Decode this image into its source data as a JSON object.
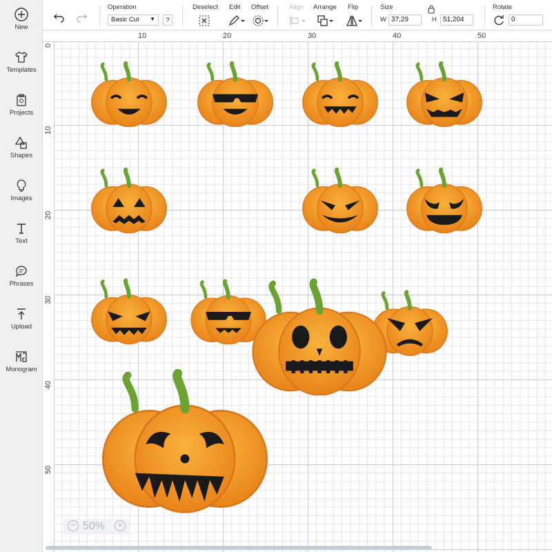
{
  "sidebar": {
    "items": [
      {
        "label": "New",
        "icon": "plus-circle-icon"
      },
      {
        "label": "Templates",
        "icon": "tshirt-icon"
      },
      {
        "label": "Projects",
        "icon": "projects-icon"
      },
      {
        "label": "Shapes",
        "icon": "shapes-icon"
      },
      {
        "label": "Images",
        "icon": "lightbulb-icon"
      },
      {
        "label": "Text",
        "icon": "text-icon"
      },
      {
        "label": "Phrases",
        "icon": "speech-bubble-icon"
      },
      {
        "label": "Upload",
        "icon": "upload-icon"
      },
      {
        "label": "Monogram",
        "icon": "monogram-icon"
      }
    ]
  },
  "toolbar": {
    "operation_title": "Operation",
    "operation_value": "Basic Cut",
    "help_label": "?",
    "deselect_title": "Deselect",
    "edit_title": "Edit",
    "offset_title": "Offset",
    "align_title": "Align",
    "arrange_title": "Arrange",
    "flip_title": "Flip",
    "size_title": "Size",
    "width_label": "W",
    "width_value": "37,29",
    "height_label": "H",
    "height_value": "51,204",
    "rotate_title": "Rotate",
    "rotate_value": "0"
  },
  "rulers": {
    "top": [
      "10",
      "20",
      "30",
      "40",
      "50"
    ],
    "left": [
      "0",
      "10",
      "20",
      "30",
      "40",
      "50"
    ]
  },
  "zoom": {
    "minus": "−",
    "value": "50%",
    "plus": "+"
  },
  "colors": {
    "pumpkin": "#f39a1e",
    "pumpkin_dark": "#e07b12",
    "stem": "#6aa332",
    "face": "#1a1a1a",
    "sidebar_bg": "#eef0f2"
  }
}
